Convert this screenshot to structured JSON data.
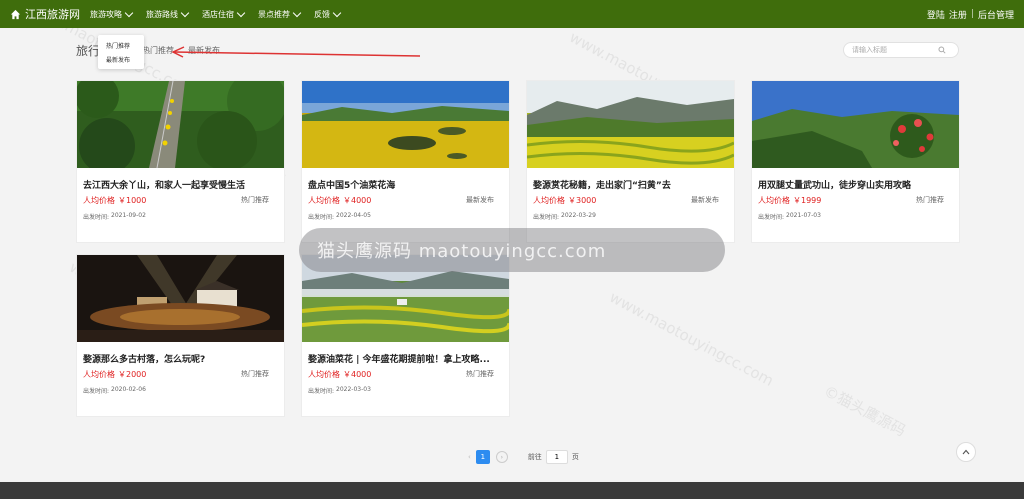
{
  "brand": {
    "name": "江西旅游网"
  },
  "nav": [
    {
      "label": "旅游攻略"
    },
    {
      "label": "旅游路线"
    },
    {
      "label": "酒店住宿"
    },
    {
      "label": "景点推荐"
    },
    {
      "label": "反馈"
    }
  ],
  "user_links": {
    "login": "登陆",
    "register": "注册",
    "admin": "后台管理"
  },
  "dropdown": {
    "items": [
      "热门推荐",
      "最新发布"
    ]
  },
  "filter": {
    "heading": "旅行",
    "tabs": [
      "热门推荐",
      "最新发布"
    ]
  },
  "search": {
    "placeholder": "请输入标题"
  },
  "cards": [
    {
      "title": "去江西大余丫山，和家人一起享受慢生活",
      "price_label": "人均价格",
      "price": "￥1000",
      "tag": "热门推荐",
      "date_label": "出发时间:",
      "date": "2021-09-02"
    },
    {
      "title": "盘点中国5个油菜花海",
      "price_label": "人均价格",
      "price": "￥4000",
      "tag": "最新发布",
      "date_label": "出发时间:",
      "date": "2022-04-05"
    },
    {
      "title": "婺源赏花秘籍，走出家门“扫黄”去",
      "price_label": "人均价格",
      "price": "￥3000",
      "tag": "最新发布",
      "date_label": "出发时间:",
      "date": "2022-03-29"
    },
    {
      "title": "用双腿丈量武功山，徒步穿山实用攻略",
      "price_label": "人均价格",
      "price": "￥1999",
      "tag": "热门推荐",
      "date_label": "出发时间:",
      "date": "2021-07-03"
    },
    {
      "title": "婺源那么多古村落，怎么玩呢?",
      "price_label": "人均价格",
      "price": "￥2000",
      "tag": "热门推荐",
      "date_label": "出发时间:",
      "date": "2020-02-06"
    },
    {
      "title": "婺源油菜花 | 今年盛花期提前啦！拿上攻略...",
      "price_label": "人均价格",
      "price": "￥4000",
      "tag": "热门推荐",
      "date_label": "出发时间:",
      "date": "2022-03-03"
    }
  ],
  "pagination": {
    "current": "1",
    "goto_label": "前往",
    "page_input": "1",
    "page_suffix": "页"
  },
  "watermark": {
    "band_text": "猫头鹰源码 maotouyingcc.com",
    "text": "www.maotouyingcc.com",
    "text_alt": "©猫头鹰源码"
  },
  "colors": {
    "header": "#3f6d0c",
    "price": "#e02020",
    "page_active": "#2d8cf0"
  }
}
